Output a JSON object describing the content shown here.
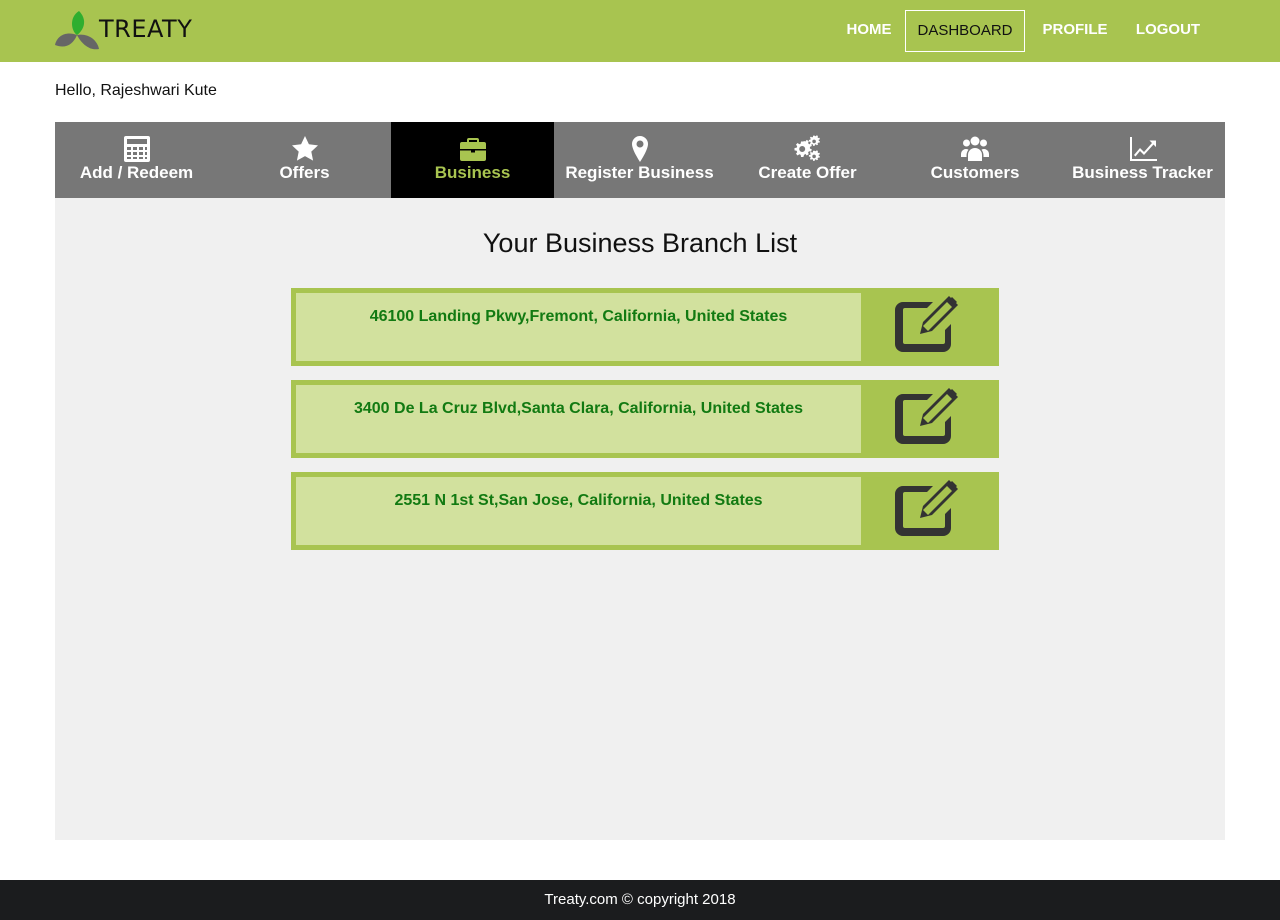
{
  "header": {
    "brand": "TREATY",
    "nav": [
      {
        "label": "HOME",
        "active": false
      },
      {
        "label": "DASHBOARD",
        "active": true
      },
      {
        "label": "PROFILE",
        "active": false
      },
      {
        "label": "LOGOUT",
        "active": false
      }
    ]
  },
  "greeting": "Hello, Rajeshwari Kute",
  "tabs": [
    {
      "label": "Add / Redeem",
      "icon": "calculator-icon",
      "active": false
    },
    {
      "label": "Offers",
      "icon": "star-icon",
      "active": false
    },
    {
      "label": "Business",
      "icon": "briefcase-icon",
      "active": true
    },
    {
      "label": "Register Business",
      "icon": "map-marker-icon",
      "active": false
    },
    {
      "label": "Create Offer",
      "icon": "gears-icon",
      "active": false
    },
    {
      "label": "Customers",
      "icon": "users-icon",
      "active": false
    },
    {
      "label": "Business Tracker",
      "icon": "line-chart-icon",
      "active": false
    }
  ],
  "main": {
    "title": "Your Business Branch List",
    "branches": [
      {
        "address": "46100 Landing Pkwy,Fremont, California, United States"
      },
      {
        "address": "3400 De La Cruz Blvd,Santa Clara, California, United States"
      },
      {
        "address": "2551 N 1st St,San Jose, California, United States"
      }
    ]
  },
  "footer": {
    "text": "Treaty.com © copyright 2018"
  },
  "colors": {
    "brand_green": "#a8c450",
    "tab_gray": "#777777",
    "active_tab": "#000000",
    "branch_bg": "#d2e19e",
    "branch_text": "#127a12",
    "footer_bg": "#1b1c1e"
  }
}
